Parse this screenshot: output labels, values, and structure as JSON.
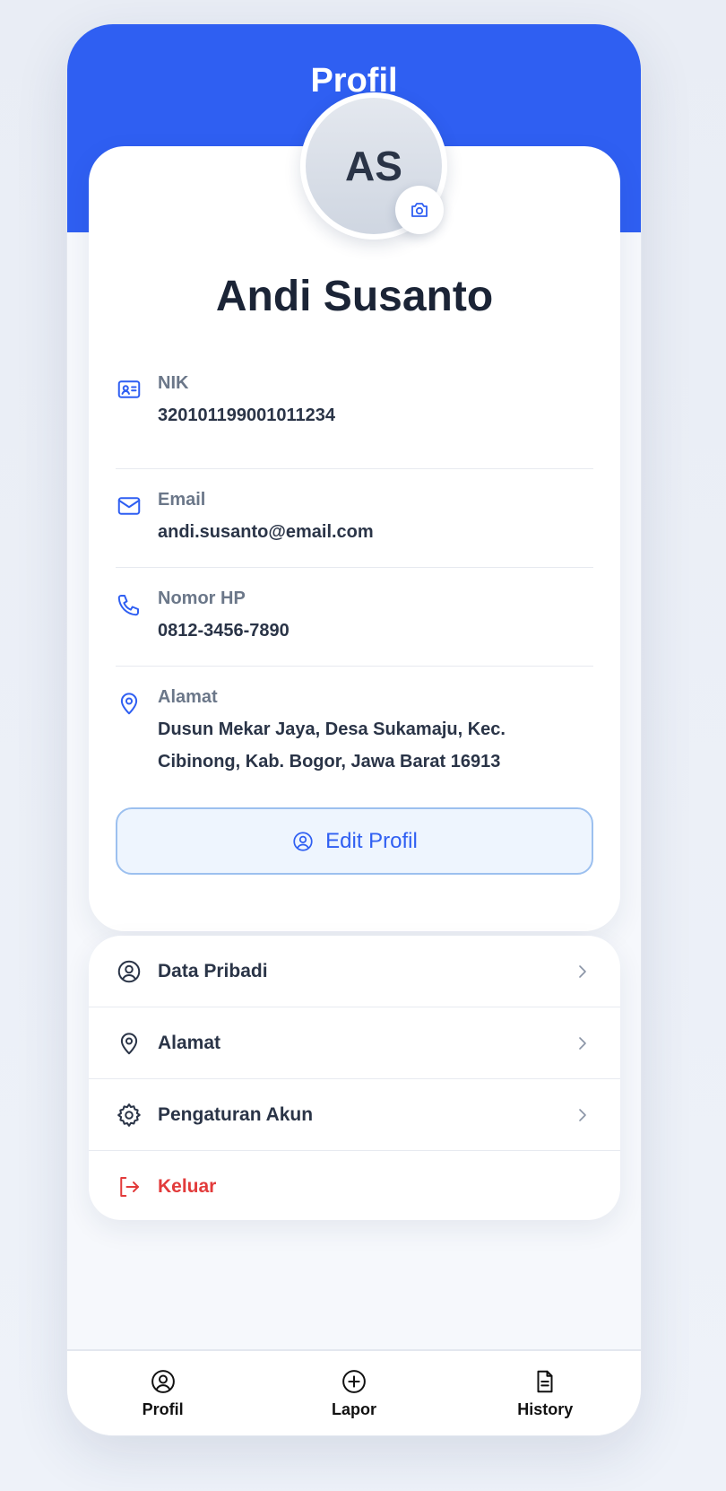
{
  "header": {
    "title": "Profil"
  },
  "profile": {
    "initials": "AS",
    "name": "Andi Susanto",
    "fields": {
      "nik": {
        "label": "NIK",
        "value": "320101199001011234",
        "icon": "id-card-icon"
      },
      "email": {
        "label": "Email",
        "value": "andi.susanto@email.com",
        "icon": "mail-icon"
      },
      "phone": {
        "label": "Nomor HP",
        "value": "0812-3456-7890",
        "icon": "phone-icon"
      },
      "address": {
        "label": "Alamat",
        "value": "Dusun Mekar Jaya, Desa Sukamaju, Kec. Cibinong, Kab. Bogor, Jawa Barat 16913",
        "icon": "map-pin-icon"
      }
    },
    "edit_button": "Edit Profil"
  },
  "menu": {
    "items": [
      {
        "label": "Data Pribadi",
        "icon": "user-circle-icon"
      },
      {
        "label": "Alamat",
        "icon": "map-pin-icon"
      },
      {
        "label": "Pengaturan Akun",
        "icon": "gear-icon"
      },
      {
        "label": "Keluar",
        "icon": "logout-icon"
      }
    ]
  },
  "bottom_nav": {
    "items": [
      {
        "label": "Profil",
        "icon": "user-circle-icon"
      },
      {
        "label": "Lapor",
        "icon": "plus-circle-icon"
      },
      {
        "label": "History",
        "icon": "document-icon"
      }
    ]
  },
  "colors": {
    "primary": "#2f5ff2",
    "danger": "#e23b3b",
    "text_dark": "#1b2436",
    "text_muted": "#6b7789"
  }
}
